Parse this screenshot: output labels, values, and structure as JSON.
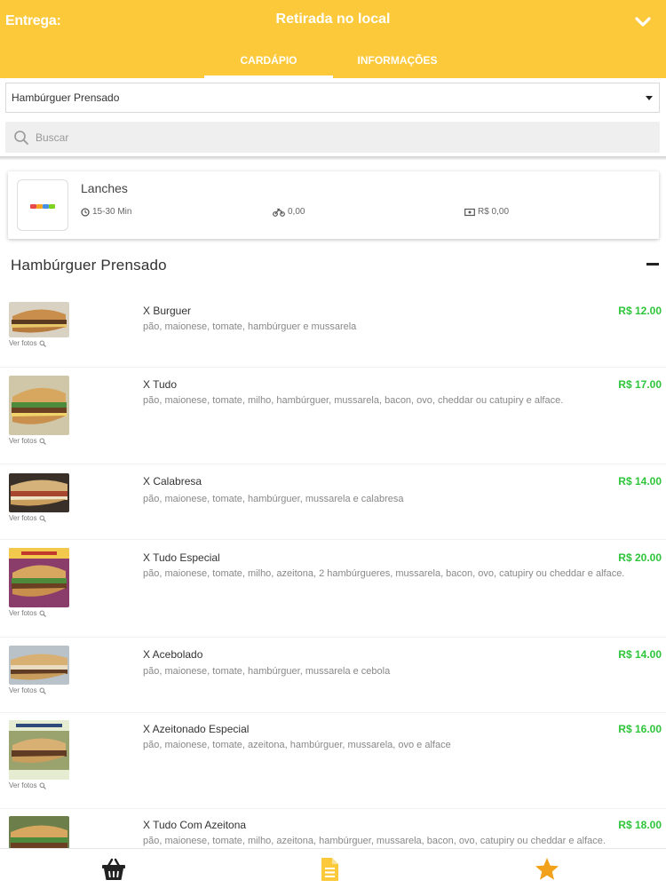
{
  "header": {
    "mode_left": "Entrega:",
    "mode_center": "Retirada no local",
    "tabs": [
      {
        "label": "CARDÁPIO",
        "active": true
      },
      {
        "label": "INFORMAÇÕES",
        "active": false
      }
    ],
    "accent_color": "#fcc93a"
  },
  "category_select": {
    "selected": "Hambúrguer Prensado"
  },
  "search": {
    "placeholder": "Buscar"
  },
  "store": {
    "name": "Lanches",
    "time": "15-30 Min",
    "delivery_fee": "0,00",
    "min_order": "R$ 0,00"
  },
  "section": {
    "title": "Hambúrguer Prensado"
  },
  "ver_fotos_label": "Ver fotos",
  "products": [
    {
      "name": "X Burguer",
      "description": "pão, maionese, tomate, hambúrguer e mussarela",
      "price": "R$ 12.00"
    },
    {
      "name": "X Tudo",
      "description": "pão, maionese, tomate, milho, hambúrguer, mussarela, bacon, ovo, cheddar ou catupiry e alface.",
      "price": "R$ 17.00"
    },
    {
      "name": "X Calabresa",
      "description": "pão, maionese, tomate, hambúrguer, mussarela e calabresa",
      "price": "R$ 14.00"
    },
    {
      "name": "X Tudo Especial",
      "description": "pão, maionese, tomate, milho, azeitona, 2 hambúrgueres, mussarela, bacon, ovo, catupiry ou cheddar e alface.",
      "price": "R$ 20.00"
    },
    {
      "name": "X Acebolado",
      "description": "pão, maionese, tomate, hambúrguer, mussarela e cebola",
      "price": "R$ 14.00"
    },
    {
      "name": "X Azeitonado Especial",
      "description": "pão, maionese, tomate, azeitona, hambúrguer, mussarela, ovo e alface",
      "price": "R$ 16.00"
    },
    {
      "name": "X Tudo Com Azeitona",
      "description": "pão, maionese, tomate, milho, azeitona, hambúrguer, mussarela, bacon, ovo, catupiry ou cheddar e alface.",
      "price": "R$ 18.00"
    }
  ],
  "bottom_nav": [
    {
      "icon": "basket-icon"
    },
    {
      "icon": "document-icon"
    },
    {
      "icon": "star-icon"
    }
  ]
}
